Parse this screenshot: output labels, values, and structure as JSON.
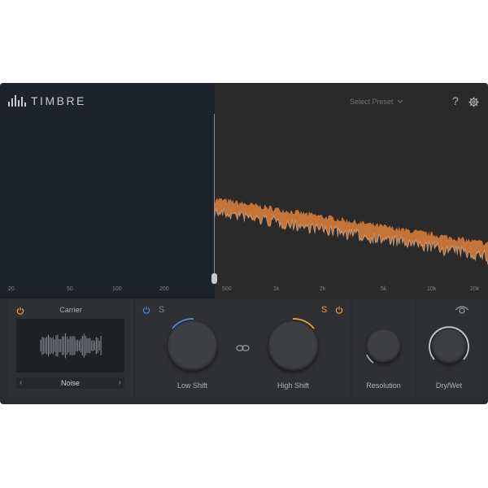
{
  "header": {
    "app_title": "TIMBRE",
    "preset_label": "Select Preset",
    "help_label": "?"
  },
  "frequency_axis": {
    "ticks": [
      "20",
      "50",
      "100",
      "200",
      "500",
      "1k",
      "2k",
      "5k",
      "10k",
      "20k"
    ]
  },
  "carrier": {
    "title": "Carrier",
    "source": "Noise",
    "prev_label": "‹",
    "next_label": "›"
  },
  "shift": {
    "low_label": "Low Shift",
    "high_label": "High Shift",
    "low_s": "S",
    "high_s": "S"
  },
  "resolution": {
    "label": "Resolution"
  },
  "drywet": {
    "label": "Dry/Wet"
  },
  "colors": {
    "accent_orange": "#f0a040",
    "accent_blue": "#4a90e2",
    "left_bg": "#1e222b",
    "right_bg": "#2a2a2b"
  }
}
